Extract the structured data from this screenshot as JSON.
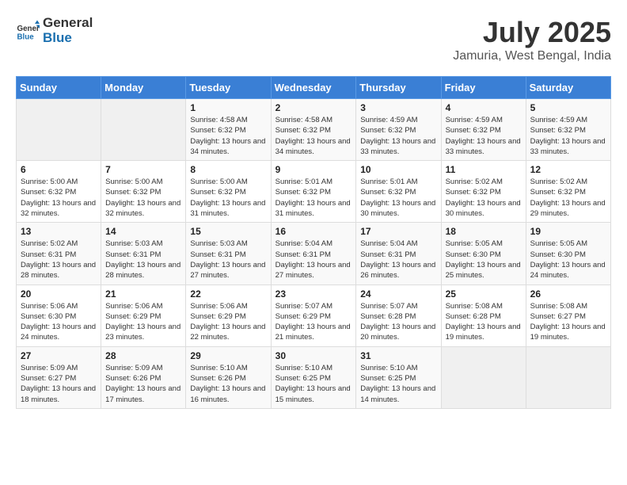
{
  "header": {
    "logo_general": "General",
    "logo_blue": "Blue",
    "month_year": "July 2025",
    "location": "Jamuria, West Bengal, India"
  },
  "weekdays": [
    "Sunday",
    "Monday",
    "Tuesday",
    "Wednesday",
    "Thursday",
    "Friday",
    "Saturday"
  ],
  "weeks": [
    [
      {
        "day": "",
        "info": ""
      },
      {
        "day": "",
        "info": ""
      },
      {
        "day": "1",
        "info": "Sunrise: 4:58 AM\nSunset: 6:32 PM\nDaylight: 13 hours and 34 minutes."
      },
      {
        "day": "2",
        "info": "Sunrise: 4:58 AM\nSunset: 6:32 PM\nDaylight: 13 hours and 34 minutes."
      },
      {
        "day": "3",
        "info": "Sunrise: 4:59 AM\nSunset: 6:32 PM\nDaylight: 13 hours and 33 minutes."
      },
      {
        "day": "4",
        "info": "Sunrise: 4:59 AM\nSunset: 6:32 PM\nDaylight: 13 hours and 33 minutes."
      },
      {
        "day": "5",
        "info": "Sunrise: 4:59 AM\nSunset: 6:32 PM\nDaylight: 13 hours and 33 minutes."
      }
    ],
    [
      {
        "day": "6",
        "info": "Sunrise: 5:00 AM\nSunset: 6:32 PM\nDaylight: 13 hours and 32 minutes."
      },
      {
        "day": "7",
        "info": "Sunrise: 5:00 AM\nSunset: 6:32 PM\nDaylight: 13 hours and 32 minutes."
      },
      {
        "day": "8",
        "info": "Sunrise: 5:00 AM\nSunset: 6:32 PM\nDaylight: 13 hours and 31 minutes."
      },
      {
        "day": "9",
        "info": "Sunrise: 5:01 AM\nSunset: 6:32 PM\nDaylight: 13 hours and 31 minutes."
      },
      {
        "day": "10",
        "info": "Sunrise: 5:01 AM\nSunset: 6:32 PM\nDaylight: 13 hours and 30 minutes."
      },
      {
        "day": "11",
        "info": "Sunrise: 5:02 AM\nSunset: 6:32 PM\nDaylight: 13 hours and 30 minutes."
      },
      {
        "day": "12",
        "info": "Sunrise: 5:02 AM\nSunset: 6:32 PM\nDaylight: 13 hours and 29 minutes."
      }
    ],
    [
      {
        "day": "13",
        "info": "Sunrise: 5:02 AM\nSunset: 6:31 PM\nDaylight: 13 hours and 28 minutes."
      },
      {
        "day": "14",
        "info": "Sunrise: 5:03 AM\nSunset: 6:31 PM\nDaylight: 13 hours and 28 minutes."
      },
      {
        "day": "15",
        "info": "Sunrise: 5:03 AM\nSunset: 6:31 PM\nDaylight: 13 hours and 27 minutes."
      },
      {
        "day": "16",
        "info": "Sunrise: 5:04 AM\nSunset: 6:31 PM\nDaylight: 13 hours and 27 minutes."
      },
      {
        "day": "17",
        "info": "Sunrise: 5:04 AM\nSunset: 6:31 PM\nDaylight: 13 hours and 26 minutes."
      },
      {
        "day": "18",
        "info": "Sunrise: 5:05 AM\nSunset: 6:30 PM\nDaylight: 13 hours and 25 minutes."
      },
      {
        "day": "19",
        "info": "Sunrise: 5:05 AM\nSunset: 6:30 PM\nDaylight: 13 hours and 24 minutes."
      }
    ],
    [
      {
        "day": "20",
        "info": "Sunrise: 5:06 AM\nSunset: 6:30 PM\nDaylight: 13 hours and 24 minutes."
      },
      {
        "day": "21",
        "info": "Sunrise: 5:06 AM\nSunset: 6:29 PM\nDaylight: 13 hours and 23 minutes."
      },
      {
        "day": "22",
        "info": "Sunrise: 5:06 AM\nSunset: 6:29 PM\nDaylight: 13 hours and 22 minutes."
      },
      {
        "day": "23",
        "info": "Sunrise: 5:07 AM\nSunset: 6:29 PM\nDaylight: 13 hours and 21 minutes."
      },
      {
        "day": "24",
        "info": "Sunrise: 5:07 AM\nSunset: 6:28 PM\nDaylight: 13 hours and 20 minutes."
      },
      {
        "day": "25",
        "info": "Sunrise: 5:08 AM\nSunset: 6:28 PM\nDaylight: 13 hours and 19 minutes."
      },
      {
        "day": "26",
        "info": "Sunrise: 5:08 AM\nSunset: 6:27 PM\nDaylight: 13 hours and 19 minutes."
      }
    ],
    [
      {
        "day": "27",
        "info": "Sunrise: 5:09 AM\nSunset: 6:27 PM\nDaylight: 13 hours and 18 minutes."
      },
      {
        "day": "28",
        "info": "Sunrise: 5:09 AM\nSunset: 6:26 PM\nDaylight: 13 hours and 17 minutes."
      },
      {
        "day": "29",
        "info": "Sunrise: 5:10 AM\nSunset: 6:26 PM\nDaylight: 13 hours and 16 minutes."
      },
      {
        "day": "30",
        "info": "Sunrise: 5:10 AM\nSunset: 6:25 PM\nDaylight: 13 hours and 15 minutes."
      },
      {
        "day": "31",
        "info": "Sunrise: 5:10 AM\nSunset: 6:25 PM\nDaylight: 13 hours and 14 minutes."
      },
      {
        "day": "",
        "info": ""
      },
      {
        "day": "",
        "info": ""
      }
    ]
  ]
}
